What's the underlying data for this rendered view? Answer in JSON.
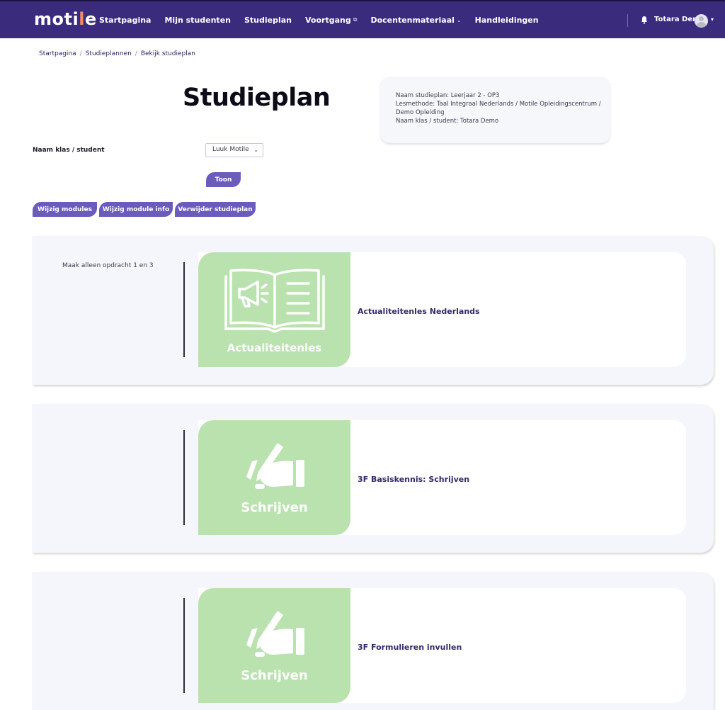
{
  "nav": {
    "logo": "motile",
    "logo_pre": "moti",
    "logo_accent": "l",
    "logo_post": "e",
    "items": [
      {
        "label": "Startpagina",
        "suffix": ""
      },
      {
        "label": "Mijn studenten",
        "suffix": ""
      },
      {
        "label": "Studieplan",
        "suffix": ""
      },
      {
        "label": "Voortgang",
        "suffix": "⧉"
      },
      {
        "label": "Docentenmateriaal",
        "suffix": "⌄"
      },
      {
        "label": "Handleidingen",
        "suffix": ""
      }
    ],
    "user_name": "Totara Demo",
    "colors": {
      "navbar": "#3b2b7d",
      "accent": "#f08a6a"
    }
  },
  "breadcrumb": [
    "Startpagina",
    "Studieplannen",
    "Bekijk studieplan"
  ],
  "page_title": "Studieplan",
  "info": {
    "line1": "Naam studieplan: Leerjaar 2 - OP3",
    "line2": "Lesmethode: Taal Integraal Nederlands / Motile Opleidingscentrum /",
    "line3": "Demo Opleiding",
    "line4": "Naam klas / student: Totara Demo"
  },
  "form": {
    "label": "Naam klas / student",
    "selected": "Luuk Motile",
    "toon_label": "Toon"
  },
  "actions": {
    "wijzig_modules": "Wijzig modules",
    "wijzig_module_info": "Wijzig module info",
    "verwijder_studieplan": "Verwijder studieplan",
    "button_color": "#6b5bbd"
  },
  "modules": [
    {
      "note": "Maak alleen opdracht 1 en 3",
      "image_label": "Actualiteitenles",
      "icon": "book-megaphone-icon",
      "title": "Actualiteitenles Nederlands"
    },
    {
      "note": "",
      "image_label": "Schrijven",
      "icon": "hand-writing-icon",
      "title": "3F Basiskennis: Schrijven"
    },
    {
      "note": "",
      "image_label": "Schrijven",
      "icon": "hand-writing-icon",
      "title": "3F Formulieren invullen"
    }
  ],
  "module_image_color": "#b9e2ae"
}
